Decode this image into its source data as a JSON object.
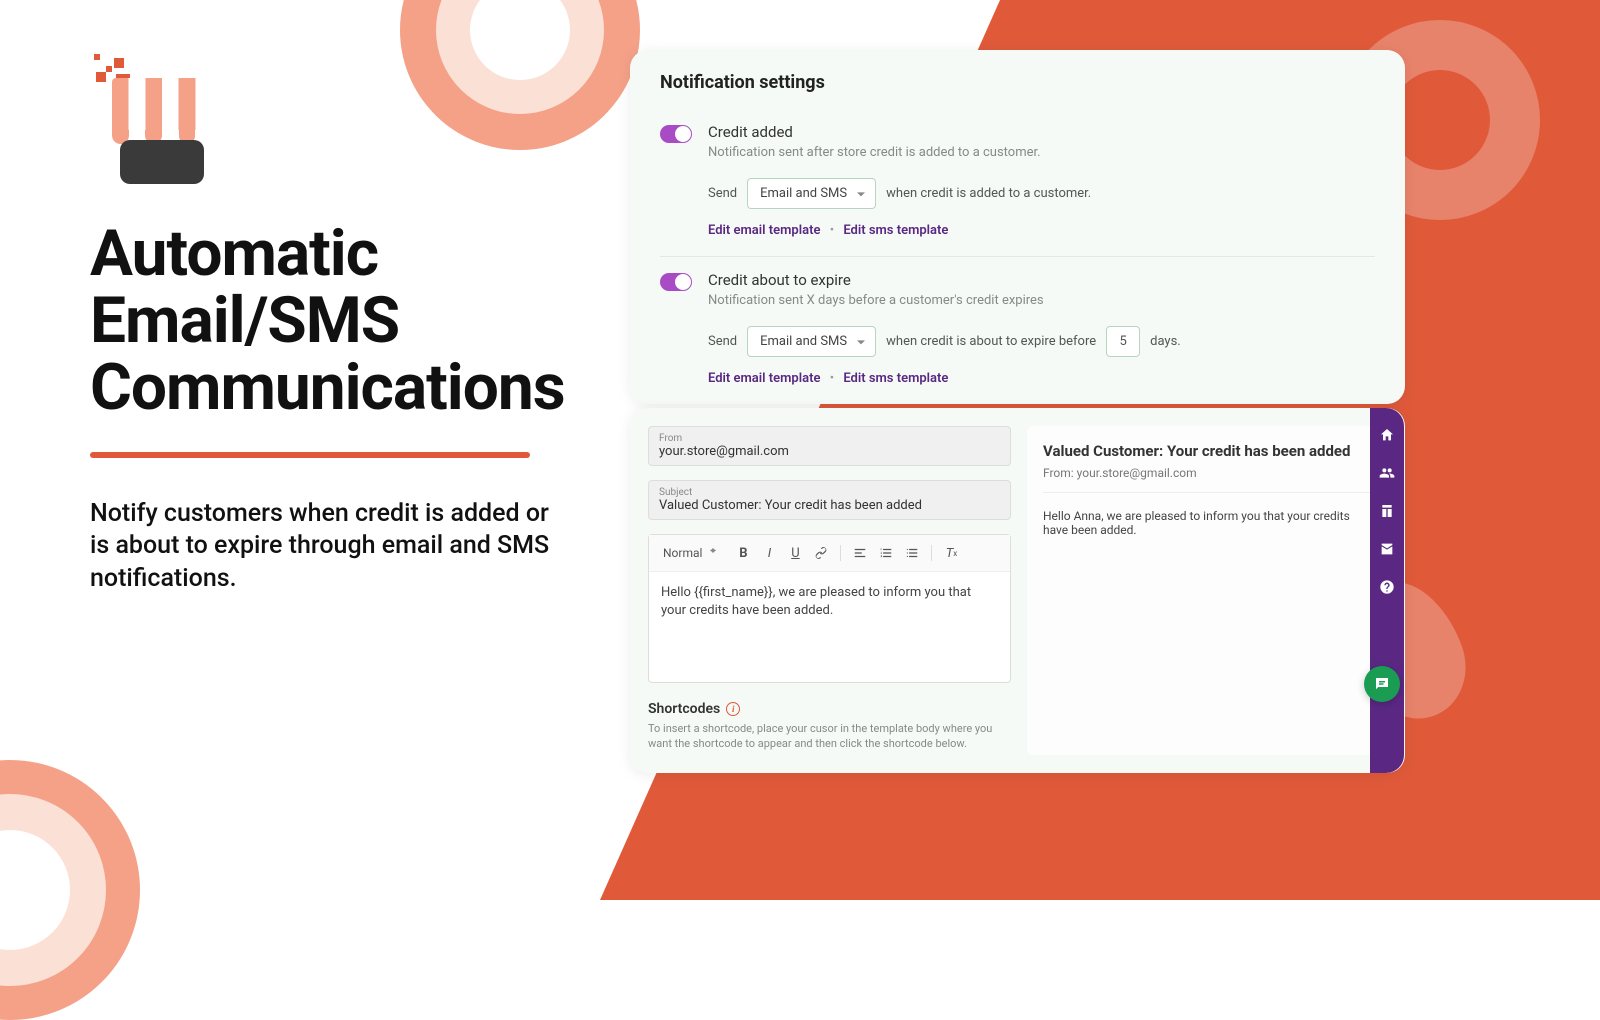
{
  "hero": {
    "title": "Automatic Email/SMS Communications",
    "subtitle": "Notify customers when credit is added or is about to expire through email and SMS notifications."
  },
  "settings": {
    "heading": "Notification settings",
    "credit_added": {
      "title": "Credit added",
      "desc": "Notification sent after store credit is added to a customer.",
      "send_label": "Send",
      "dropdown": "Email and SMS",
      "suffix": "when credit is added to a customer.",
      "edit_email": "Edit email template",
      "edit_sms": "Edit sms template"
    },
    "credit_expire": {
      "title": "Credit about to expire",
      "desc": "Notification sent X days before a customer's credit expires",
      "send_label": "Send",
      "dropdown": "Email and SMS",
      "mid": "when credit is about to expire before",
      "days_value": "5",
      "days_label": "days.",
      "edit_email": "Edit email template",
      "edit_sms": "Edit sms template"
    }
  },
  "editor": {
    "from_label": "From",
    "from_value": "your.store@gmail.com",
    "subject_label": "Subject",
    "subject_value": "Valued Customer: Your credit has been added",
    "format_style": "Normal",
    "body": "Hello {{first_name}}, we are pleased to inform you that your credits have been added.",
    "shortcodes_title": "Shortcodes",
    "shortcodes_desc": "To insert a shortcode, place your cusor in the template body where you want the shortcode to appear and then click the shortcode below."
  },
  "preview": {
    "title": "Valued Customer: Your credit has been added",
    "from": "From: your.store@gmail.com",
    "body": "Hello Anna, we are pleased to inform you that your credits have been added."
  }
}
